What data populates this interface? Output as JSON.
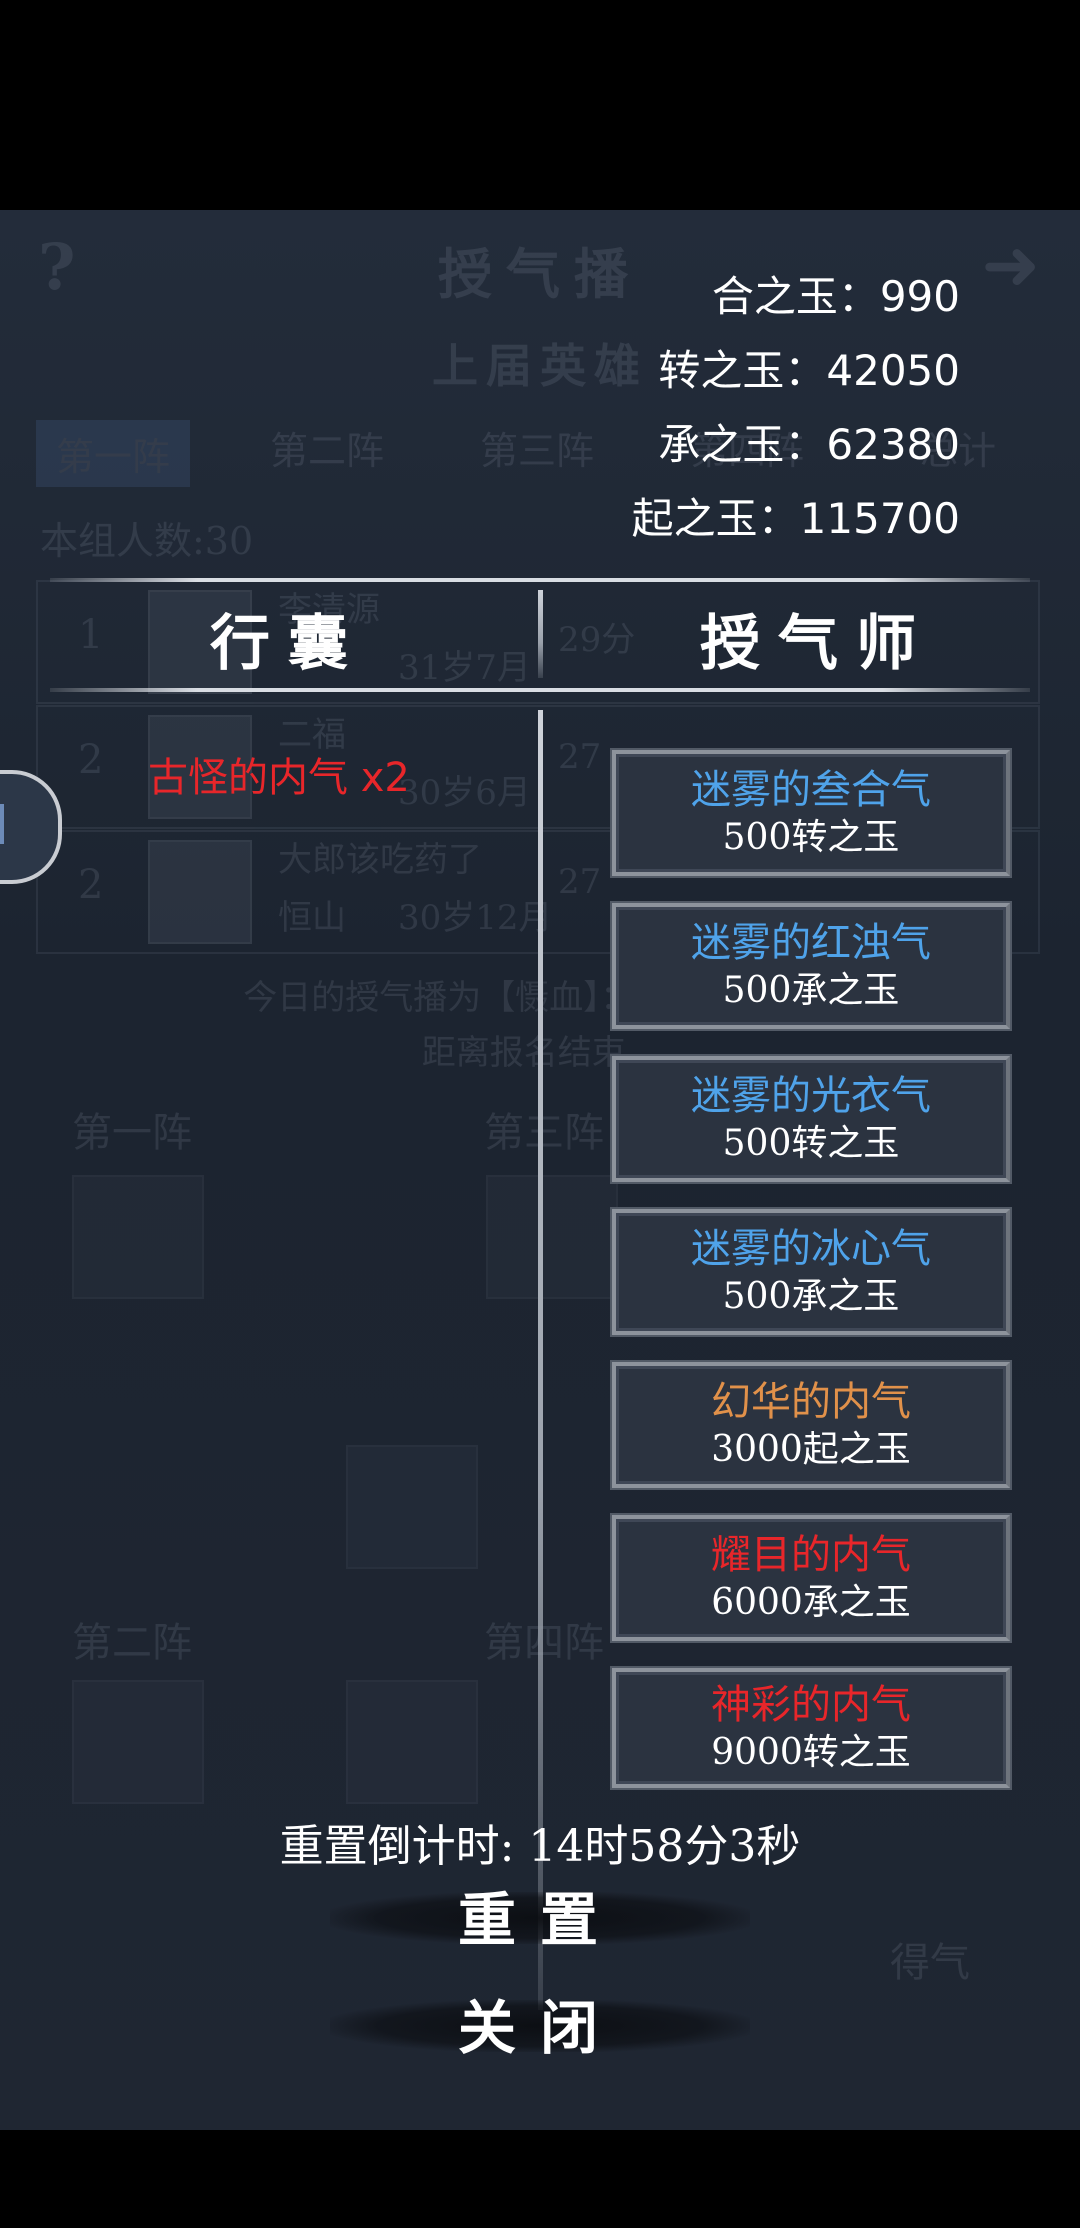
{
  "background": {
    "title": "授气播",
    "subtitle": "上届英雄",
    "tabs": [
      "第一阵",
      "第二阵",
      "第三阵",
      "第四阵",
      "总计"
    ],
    "group_count": "本组人数:30",
    "rows": [
      {
        "rank": "1",
        "name": "李清源",
        "age": "31岁7月",
        "score": "29分"
      },
      {
        "rank": "2",
        "name": "二福",
        "age": "30岁6月",
        "score": "27"
      },
      {
        "rank": "2",
        "name": "大郎该吃药了",
        "sect": "恒山",
        "age": "30岁12月",
        "score": "27"
      }
    ],
    "news": "今日的授气播为【慑血】：释放武...气血",
    "news2": "距离报名结束...",
    "formation_labels": [
      "第一阵",
      "第三阵",
      "第二阵",
      "第四阵"
    ],
    "side_button": "得气"
  },
  "currencies": [
    {
      "label": "合之玉：",
      "value": "990"
    },
    {
      "label": "转之玉：",
      "value": "42050"
    },
    {
      "label": "承之玉：",
      "value": "62380"
    },
    {
      "label": "起之玉：",
      "value": "115700"
    }
  ],
  "headers": {
    "bag": "行囊",
    "master": "授气师"
  },
  "bag_items": [
    {
      "name": "古怪的内气 x2",
      "color": "#e8262a"
    }
  ],
  "shop_items": [
    {
      "name": "迷雾的叁合气",
      "price": "500转之玉",
      "color": "#4fa3ea"
    },
    {
      "name": "迷雾的红浊气",
      "price": "500承之玉",
      "color": "#4fa3ea"
    },
    {
      "name": "迷雾的光衣气",
      "price": "500转之玉",
      "color": "#4fa3ea"
    },
    {
      "name": "迷雾的冰心气",
      "price": "500承之玉",
      "color": "#4fa3ea"
    },
    {
      "name": "幻华的内气",
      "price": "3000起之玉",
      "color": "#e1914a"
    },
    {
      "name": "耀目的内气",
      "price": "6000承之玉",
      "color": "#e8262a"
    },
    {
      "name": "神彩的内气",
      "price": "9000转之玉",
      "color": "#e8262a"
    }
  ],
  "countdown": "重置倒计时: 14时58分3秒",
  "buttons": {
    "reset": "重置",
    "close": "关闭"
  }
}
